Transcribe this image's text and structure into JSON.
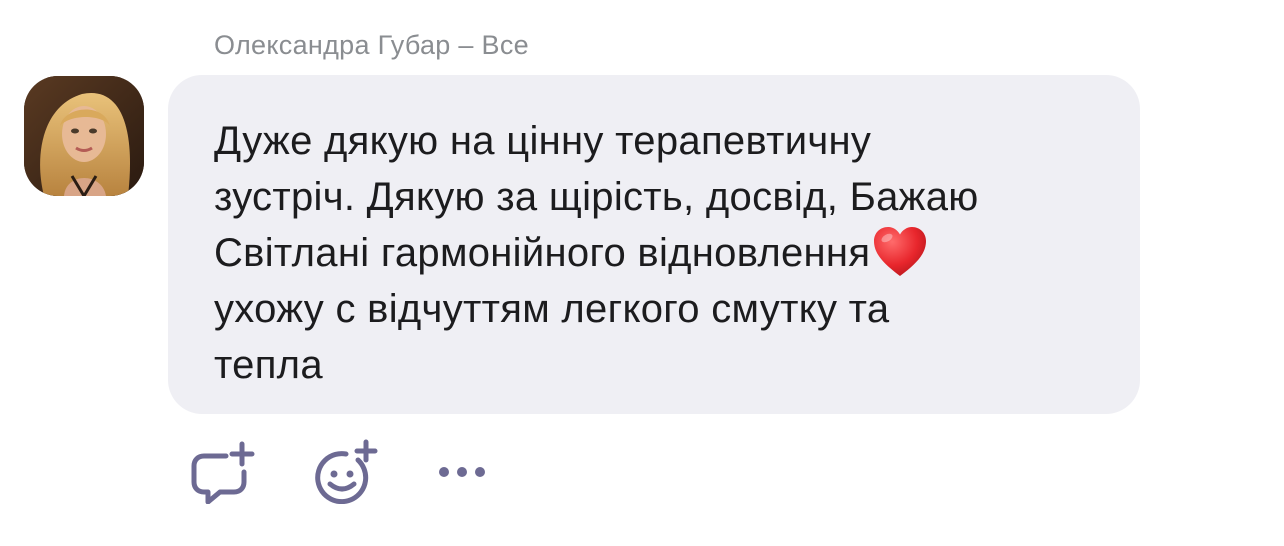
{
  "post": {
    "sender": "Олександра Губар – Все",
    "message_lines": [
      "Дуже дякую на цінну терапевтичну",
      "зустріч. Дякую за щірість, досвід, Бажаю",
      "Світлані гармонійного відновлення",
      "ухожу с відчуттям легкого смутку та",
      "тепла"
    ],
    "emoji": "red-heart"
  },
  "actions": [
    {
      "name": "reply",
      "icon": "comment-plus-icon"
    },
    {
      "name": "react",
      "icon": "smile-plus-icon"
    },
    {
      "name": "more",
      "icon": "more-horizontal-icon"
    }
  ],
  "colors": {
    "bubble": "#efeff4",
    "text": "#1c1c1e",
    "meta": "#8a8d91",
    "icon": "#6d6a93",
    "heart": "#e8262c"
  }
}
